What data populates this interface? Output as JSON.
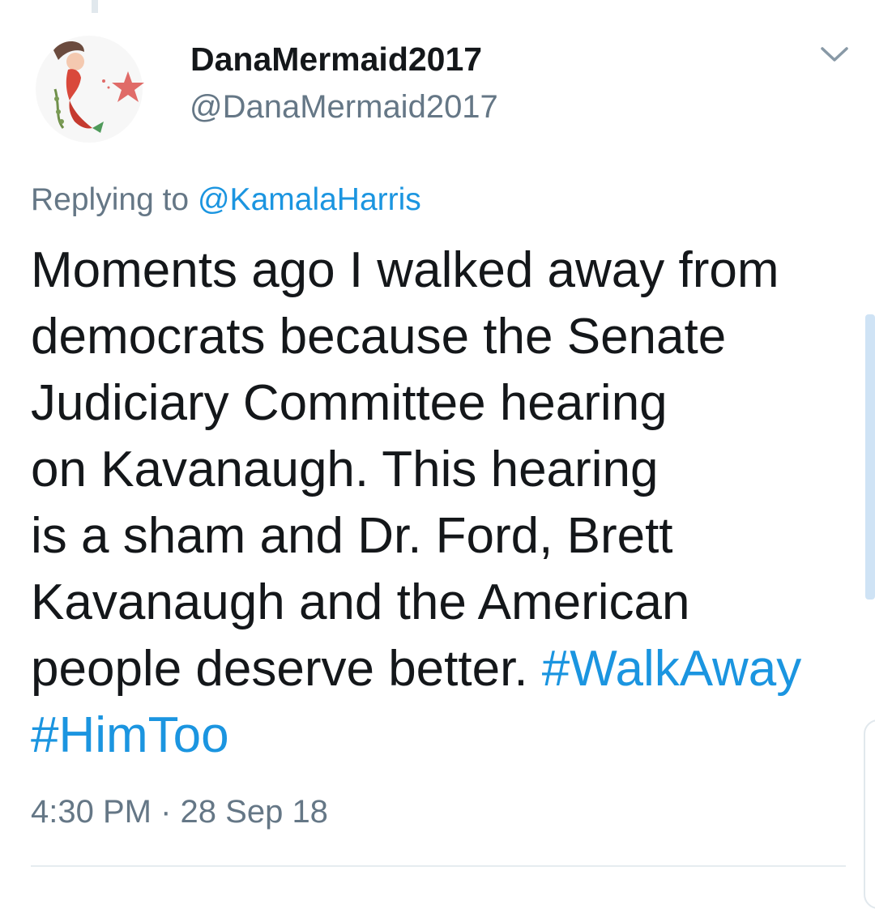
{
  "author": {
    "display_name": "DanaMermaid2017",
    "handle": "@DanaMermaid2017",
    "avatar_icon": "mermaid-starfish-avatar"
  },
  "reply": {
    "prefix": "Replying to",
    "mention": "@KamalaHarris"
  },
  "tweet": {
    "lines": [
      "Moments ago I walked away from",
      "democrats because the Senate",
      "Judiciary Committee hearing",
      "on Kavanaugh. This hearing",
      "is a sham and Dr. Ford, Brett",
      "Kavanaugh and the American",
      "people deserve better."
    ],
    "hashtag_1": "#WalkAway",
    "hashtag_2": "#HimToo"
  },
  "meta": {
    "time": "4:30 PM",
    "separator": "·",
    "date": "28 Sep 18"
  },
  "icons": {
    "menu": "chevron-down-icon"
  },
  "colors": {
    "text": "#14171a",
    "secondary": "#657786",
    "link": "#1b95e0"
  }
}
